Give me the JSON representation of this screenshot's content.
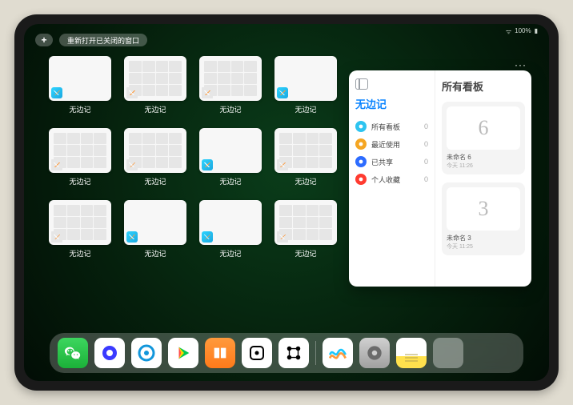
{
  "statusbar": {
    "wifi": "᯾",
    "battery": "100%"
  },
  "topbar": {
    "plus_label": "+",
    "reopen_label": "重新打开已关闭的窗口"
  },
  "thumbs": [
    {
      "label": "无边记",
      "kind": "blank"
    },
    {
      "label": "无边记",
      "kind": "calendar"
    },
    {
      "label": "无边记",
      "kind": "calendar"
    },
    {
      "label": "无边记",
      "kind": "blank"
    },
    {
      "label": "无边记",
      "kind": "calendar"
    },
    {
      "label": "无边记",
      "kind": "calendar"
    },
    {
      "label": "无边记",
      "kind": "blank"
    },
    {
      "label": "无边记",
      "kind": "calendar"
    },
    {
      "label": "无边记",
      "kind": "calendar"
    },
    {
      "label": "无边记",
      "kind": "blank"
    },
    {
      "label": "无边记",
      "kind": "blank"
    },
    {
      "label": "无边记",
      "kind": "calendar"
    }
  ],
  "panel": {
    "menu_dots": "···",
    "left_title": "无边记",
    "items": [
      {
        "label": "所有看板",
        "count": "0",
        "color": "#2ec4f0"
      },
      {
        "label": "最近使用",
        "count": "0",
        "color": "#f5a623"
      },
      {
        "label": "已共享",
        "count": "0",
        "color": "#2d6cff"
      },
      {
        "label": "个人收藏",
        "count": "0",
        "color": "#ff3b30"
      }
    ],
    "right_title": "所有看板",
    "boards": [
      {
        "glyph": "6",
        "title": "未命名 6",
        "sub": "今天 11:26"
      },
      {
        "glyph": "3",
        "title": "未命名 3",
        "sub": "今天 11:25"
      }
    ]
  },
  "dock": {
    "apps": [
      {
        "name": "wechat-icon",
        "cls": "wechat"
      },
      {
        "name": "quark-icon",
        "cls": "quark"
      },
      {
        "name": "qq-browser-icon",
        "cls": "qqb"
      },
      {
        "name": "iqiyi-icon",
        "cls": "iqiyi"
      },
      {
        "name": "books-icon",
        "cls": "books"
      },
      {
        "name": "dice-icon",
        "cls": "dice"
      },
      {
        "name": "connect-icon",
        "cls": "connect"
      }
    ],
    "recent": [
      {
        "name": "freeform-icon",
        "cls": "freeform"
      },
      {
        "name": "settings-icon",
        "cls": "settings"
      },
      {
        "name": "notes-icon",
        "cls": "notes"
      },
      {
        "name": "app-folder",
        "cls": "folder"
      }
    ]
  }
}
